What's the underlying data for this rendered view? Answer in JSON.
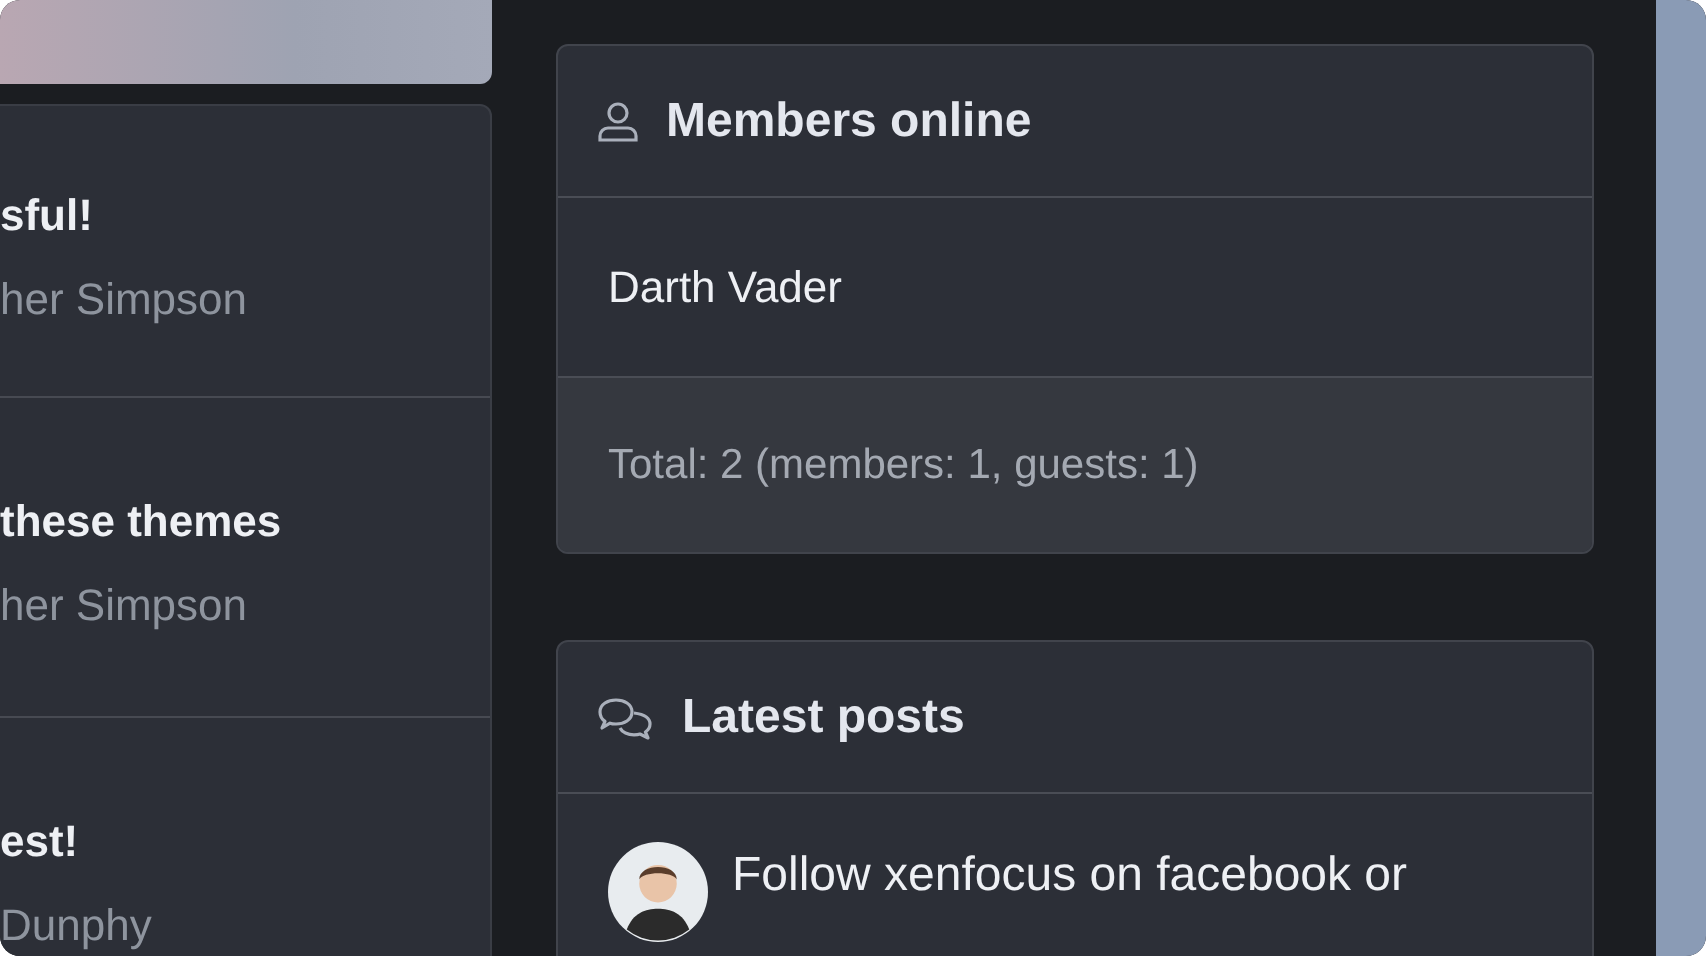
{
  "threads": [
    {
      "title": "sful!",
      "author": "her Simpson"
    },
    {
      "title": "these themes",
      "author": "her Simpson"
    },
    {
      "title": "est!",
      "author": "Dunphy"
    }
  ],
  "members_online": {
    "title": "Members online",
    "members": [
      "Darth Vader"
    ],
    "total": "Total: 2 (members: 1, guests: 1)"
  },
  "latest_posts": {
    "title": "Latest posts",
    "posts": [
      {
        "title": "Follow xenfocus on facebook or"
      }
    ]
  }
}
